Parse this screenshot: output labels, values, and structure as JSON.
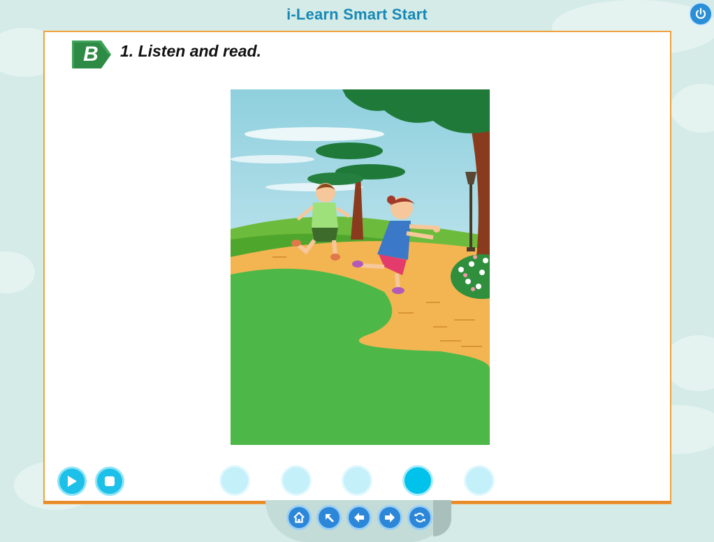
{
  "header": {
    "title": "i-Learn Smart Start"
  },
  "toolbar": {
    "power_icon": "power-icon"
  },
  "lesson": {
    "badge_letter": "B",
    "heading": "1. Listen and read.",
    "illustration": "two-children-running-in-park"
  },
  "player": {
    "play_icon": "play-icon",
    "stop_icon": "stop-icon",
    "progress": {
      "count": 5,
      "active_index": 3
    }
  },
  "navigation": {
    "buttons": [
      "home-icon",
      "up-left-arrow-icon",
      "arrow-left-icon",
      "arrow-right-icon",
      "refresh-icon"
    ]
  },
  "colors": {
    "accent": "#1cc0e8",
    "panel_border": "#f0a13c",
    "badge_green": "#2e8b45",
    "title_blue": "#1689b6",
    "nav_blue": "#2d87d8"
  }
}
